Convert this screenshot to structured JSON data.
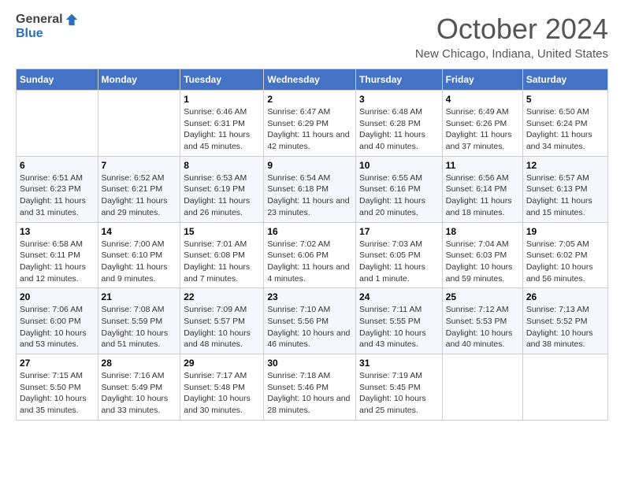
{
  "logo": {
    "general": "General",
    "blue": "Blue"
  },
  "title": "October 2024",
  "location": "New Chicago, Indiana, United States",
  "days_of_week": [
    "Sunday",
    "Monday",
    "Tuesday",
    "Wednesday",
    "Thursday",
    "Friday",
    "Saturday"
  ],
  "weeks": [
    [
      {
        "day": "",
        "detail": ""
      },
      {
        "day": "",
        "detail": ""
      },
      {
        "day": "1",
        "detail": "Sunrise: 6:46 AM\nSunset: 6:31 PM\nDaylight: 11 hours and 45 minutes."
      },
      {
        "day": "2",
        "detail": "Sunrise: 6:47 AM\nSunset: 6:29 PM\nDaylight: 11 hours and 42 minutes."
      },
      {
        "day": "3",
        "detail": "Sunrise: 6:48 AM\nSunset: 6:28 PM\nDaylight: 11 hours and 40 minutes."
      },
      {
        "day": "4",
        "detail": "Sunrise: 6:49 AM\nSunset: 6:26 PM\nDaylight: 11 hours and 37 minutes."
      },
      {
        "day": "5",
        "detail": "Sunrise: 6:50 AM\nSunset: 6:24 PM\nDaylight: 11 hours and 34 minutes."
      }
    ],
    [
      {
        "day": "6",
        "detail": "Sunrise: 6:51 AM\nSunset: 6:23 PM\nDaylight: 11 hours and 31 minutes."
      },
      {
        "day": "7",
        "detail": "Sunrise: 6:52 AM\nSunset: 6:21 PM\nDaylight: 11 hours and 29 minutes."
      },
      {
        "day": "8",
        "detail": "Sunrise: 6:53 AM\nSunset: 6:19 PM\nDaylight: 11 hours and 26 minutes."
      },
      {
        "day": "9",
        "detail": "Sunrise: 6:54 AM\nSunset: 6:18 PM\nDaylight: 11 hours and 23 minutes."
      },
      {
        "day": "10",
        "detail": "Sunrise: 6:55 AM\nSunset: 6:16 PM\nDaylight: 11 hours and 20 minutes."
      },
      {
        "day": "11",
        "detail": "Sunrise: 6:56 AM\nSunset: 6:14 PM\nDaylight: 11 hours and 18 minutes."
      },
      {
        "day": "12",
        "detail": "Sunrise: 6:57 AM\nSunset: 6:13 PM\nDaylight: 11 hours and 15 minutes."
      }
    ],
    [
      {
        "day": "13",
        "detail": "Sunrise: 6:58 AM\nSunset: 6:11 PM\nDaylight: 11 hours and 12 minutes."
      },
      {
        "day": "14",
        "detail": "Sunrise: 7:00 AM\nSunset: 6:10 PM\nDaylight: 11 hours and 9 minutes."
      },
      {
        "day": "15",
        "detail": "Sunrise: 7:01 AM\nSunset: 6:08 PM\nDaylight: 11 hours and 7 minutes."
      },
      {
        "day": "16",
        "detail": "Sunrise: 7:02 AM\nSunset: 6:06 PM\nDaylight: 11 hours and 4 minutes."
      },
      {
        "day": "17",
        "detail": "Sunrise: 7:03 AM\nSunset: 6:05 PM\nDaylight: 11 hours and 1 minute."
      },
      {
        "day": "18",
        "detail": "Sunrise: 7:04 AM\nSunset: 6:03 PM\nDaylight: 10 hours and 59 minutes."
      },
      {
        "day": "19",
        "detail": "Sunrise: 7:05 AM\nSunset: 6:02 PM\nDaylight: 10 hours and 56 minutes."
      }
    ],
    [
      {
        "day": "20",
        "detail": "Sunrise: 7:06 AM\nSunset: 6:00 PM\nDaylight: 10 hours and 53 minutes."
      },
      {
        "day": "21",
        "detail": "Sunrise: 7:08 AM\nSunset: 5:59 PM\nDaylight: 10 hours and 51 minutes."
      },
      {
        "day": "22",
        "detail": "Sunrise: 7:09 AM\nSunset: 5:57 PM\nDaylight: 10 hours and 48 minutes."
      },
      {
        "day": "23",
        "detail": "Sunrise: 7:10 AM\nSunset: 5:56 PM\nDaylight: 10 hours and 46 minutes."
      },
      {
        "day": "24",
        "detail": "Sunrise: 7:11 AM\nSunset: 5:55 PM\nDaylight: 10 hours and 43 minutes."
      },
      {
        "day": "25",
        "detail": "Sunrise: 7:12 AM\nSunset: 5:53 PM\nDaylight: 10 hours and 40 minutes."
      },
      {
        "day": "26",
        "detail": "Sunrise: 7:13 AM\nSunset: 5:52 PM\nDaylight: 10 hours and 38 minutes."
      }
    ],
    [
      {
        "day": "27",
        "detail": "Sunrise: 7:15 AM\nSunset: 5:50 PM\nDaylight: 10 hours and 35 minutes."
      },
      {
        "day": "28",
        "detail": "Sunrise: 7:16 AM\nSunset: 5:49 PM\nDaylight: 10 hours and 33 minutes."
      },
      {
        "day": "29",
        "detail": "Sunrise: 7:17 AM\nSunset: 5:48 PM\nDaylight: 10 hours and 30 minutes."
      },
      {
        "day": "30",
        "detail": "Sunrise: 7:18 AM\nSunset: 5:46 PM\nDaylight: 10 hours and 28 minutes."
      },
      {
        "day": "31",
        "detail": "Sunrise: 7:19 AM\nSunset: 5:45 PM\nDaylight: 10 hours and 25 minutes."
      },
      {
        "day": "",
        "detail": ""
      },
      {
        "day": "",
        "detail": ""
      }
    ]
  ]
}
